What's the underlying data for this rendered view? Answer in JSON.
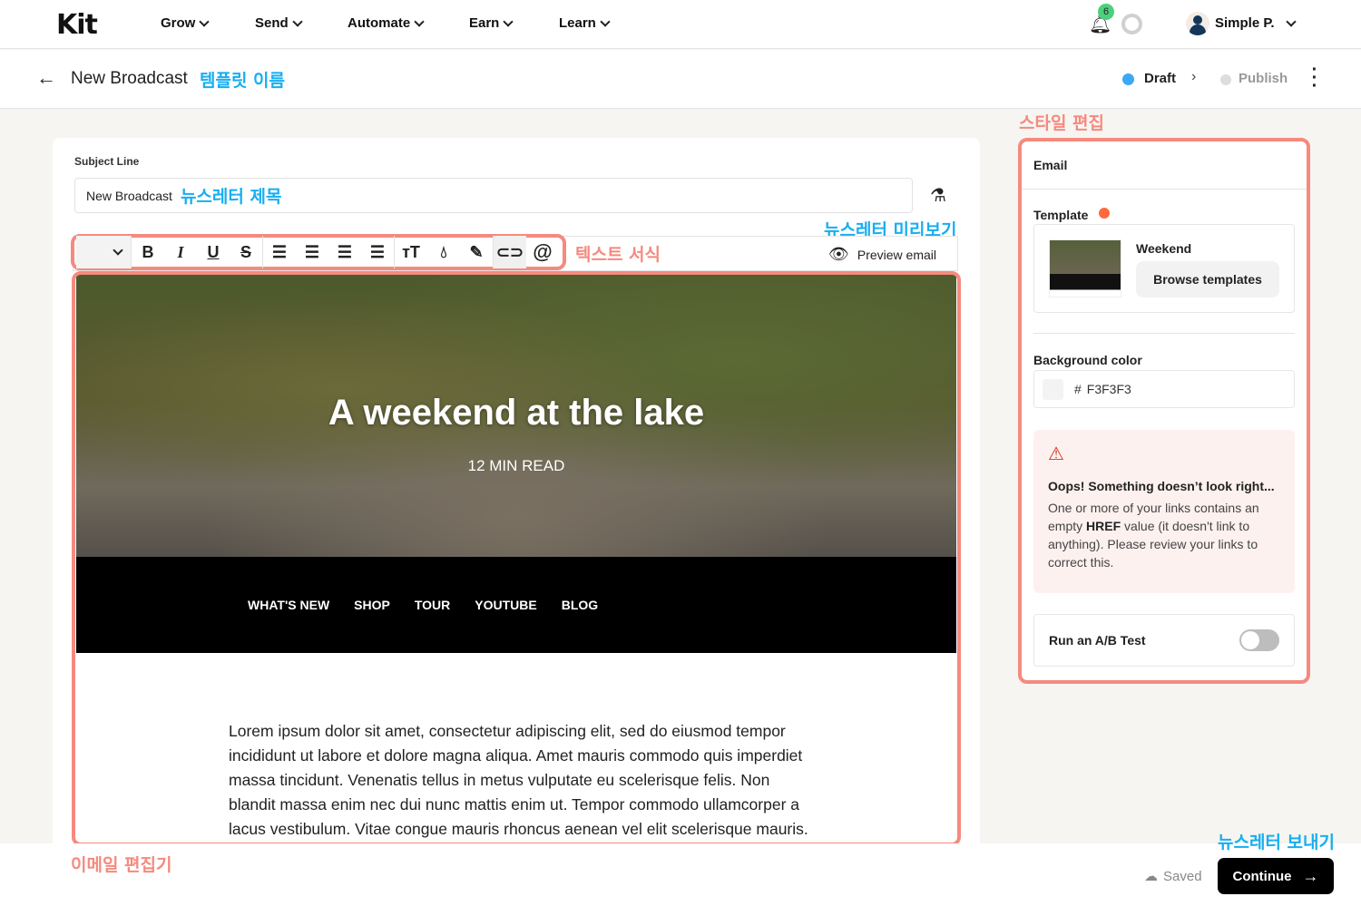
{
  "nav": {
    "logo": "Kit",
    "items": [
      "Grow",
      "Send",
      "Automate",
      "Earn",
      "Learn"
    ],
    "notifications": "6",
    "user": "Simple P."
  },
  "header": {
    "title": "New Broadcast",
    "annotation": "템플릿 이름",
    "status_draft": "Draft",
    "status_publish": "Publish"
  },
  "editor": {
    "subject_label": "Subject Line",
    "subject_value": "New Broadcast",
    "subject_annotation": "뉴스레터 제목",
    "preview_annotation": "뉴스레터 미리보기",
    "preview_label": "Preview email",
    "toolbar_annotation": "텍스트 서식",
    "editor_annotation": "이메일 편집기",
    "toolbar": [
      "chevron-down-icon",
      "bold-icon",
      "italic-icon",
      "underline-icon",
      "strikethrough-icon",
      "align-left-icon",
      "align-center-icon",
      "align-right-icon",
      "align-justify-icon",
      "text-size-icon",
      "color-drop-icon",
      "highlighter-icon",
      "link-icon",
      "at-mention-icon"
    ]
  },
  "email": {
    "hero_title": "A weekend at the lake",
    "hero_sub": "12 MIN READ",
    "menu": [
      "WHAT'S NEW",
      "SHOP",
      "TOUR",
      "YOUTUBE",
      "BLOG"
    ],
    "body": "Lorem ipsum dolor sit amet, consectetur adipiscing elit, sed do eiusmod tempor incididunt ut labore et dolore magna aliqua. Amet mauris commodo quis imperdiet massa tincidunt. Venenatis tellus in metus vulputate eu scelerisque felis. Non blandit massa enim nec dui nunc mattis enim ut. Tempor commodo ullamcorper a lacus vestibulum. Vitae congue mauris rhoncus aenean vel elit scelerisque mauris. Lobortis scelerisque fermentum dui faucibus in ornare"
  },
  "panel": {
    "annotation": "스타일 편집",
    "heading": "Email",
    "template_label": "Template",
    "template_name": "Weekend",
    "browse": "Browse templates",
    "bg_label": "Background color",
    "bg_hash": "#",
    "bg_value": "F3F3F3",
    "warn_title": "Oops! Something doesn’t look right...",
    "warn_pre": "One or more of your links contains an empty ",
    "warn_bold": "HREF",
    "warn_post": " value (it doesn't link to anything). Please review your links to correct this.",
    "ab_label": "Run an A/B Test",
    "ab_enabled": false
  },
  "footer": {
    "saved": "Saved",
    "continue": "Continue",
    "annotation": "뉴스레터 보내기"
  },
  "colors": {
    "annotation_red": "#f58a7e",
    "annotation_blue": "#17aef0",
    "draft": "#3ba8f5",
    "badge": "#4cd07d",
    "warn_bg": "#fdf1ef",
    "template_dot": "#ff6a3d"
  }
}
